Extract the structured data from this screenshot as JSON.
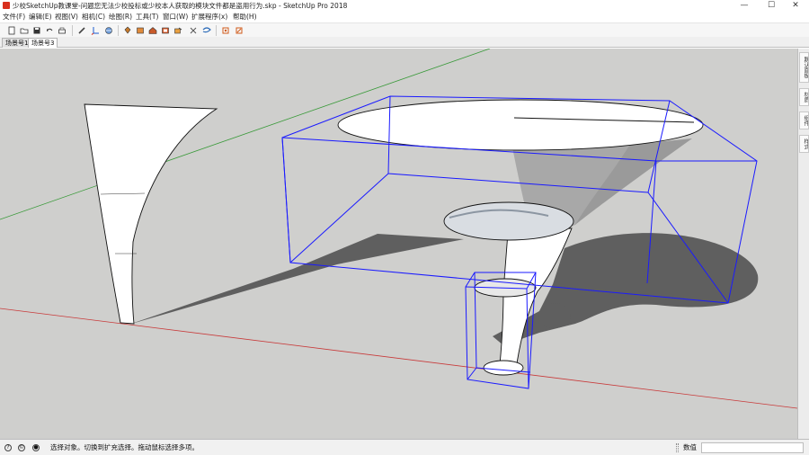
{
  "window": {
    "title": "少校SketchUp教课堂-问题您无法少校投标或少校本人获取的模块文件都是盗用行为.skp - SketchUp Pro 2018",
    "min_glyph": "—",
    "max_glyph": "☐",
    "close_glyph": "✕"
  },
  "menu": {
    "items": [
      "文件(F)",
      "编辑(E)",
      "视图(V)",
      "相机(C)",
      "绘图(R)",
      "工具(T)",
      "窗口(W)",
      "扩展程序(x)",
      "帮助(H)"
    ]
  },
  "toolbar": {
    "icons": [
      "new-file-icon",
      "open-folder-icon",
      "save-icon",
      "undo-icon",
      "print-icon",
      "pencil-icon",
      "axes-icon",
      "sandbox-icon",
      "paint-bucket-icon",
      "component-icon",
      "warehouse-icon",
      "extension-icon",
      "share-icon",
      "scissors-icon",
      "tape-icon",
      "section-plane-icon",
      "section-display-icon"
    ]
  },
  "scenes": {
    "tabs": [
      "场景号1",
      "场景号3"
    ],
    "active_index": 1
  },
  "tray": {
    "tabs": [
      "默认面板",
      "材质",
      "组件",
      "样式"
    ]
  },
  "status": {
    "message": "选择对象。切换到扩充选择。拖动鼠标选择多项。",
    "measure_label": "数值",
    "measure_value": ""
  },
  "colors": {
    "viewport_bg": "#cfcfcd",
    "selection_blue": "#1a1aff",
    "axis_green": "#3a9a3a",
    "axis_red": "#c83a3a",
    "shadow": "#5e5e5e"
  }
}
